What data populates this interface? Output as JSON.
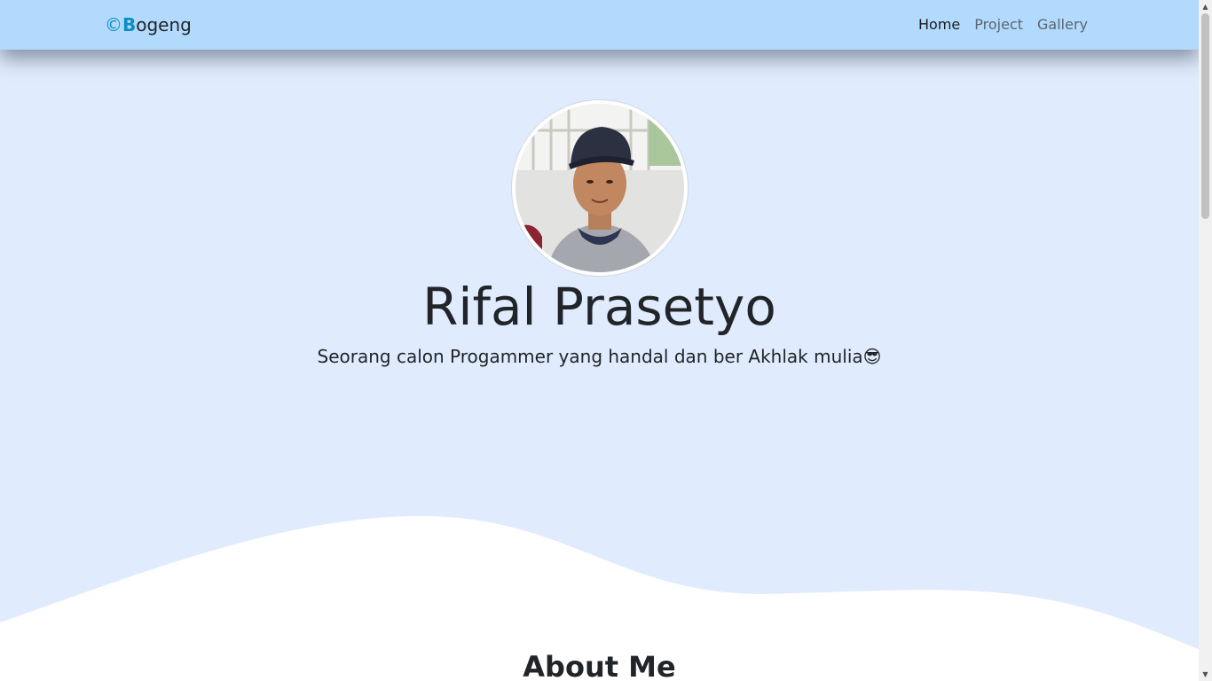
{
  "navbar": {
    "brand_symbol": "©",
    "brand_initial": "B",
    "brand_rest": "ogeng",
    "links": [
      {
        "label": "Home",
        "active": true
      },
      {
        "label": "Project",
        "active": false
      },
      {
        "label": "Gallery",
        "active": false
      }
    ],
    "background": "#b1dafc"
  },
  "hero": {
    "name": "Rifal Prasetyo",
    "tagline": "Seorang calon Progammer yang handal dan ber Akhlak mulia😎",
    "background": "#e0ebfd"
  },
  "about": {
    "title": "About Me"
  },
  "colors": {
    "accent": "#0d8fc4",
    "text": "#212529",
    "nav_link": "#5b6670"
  }
}
